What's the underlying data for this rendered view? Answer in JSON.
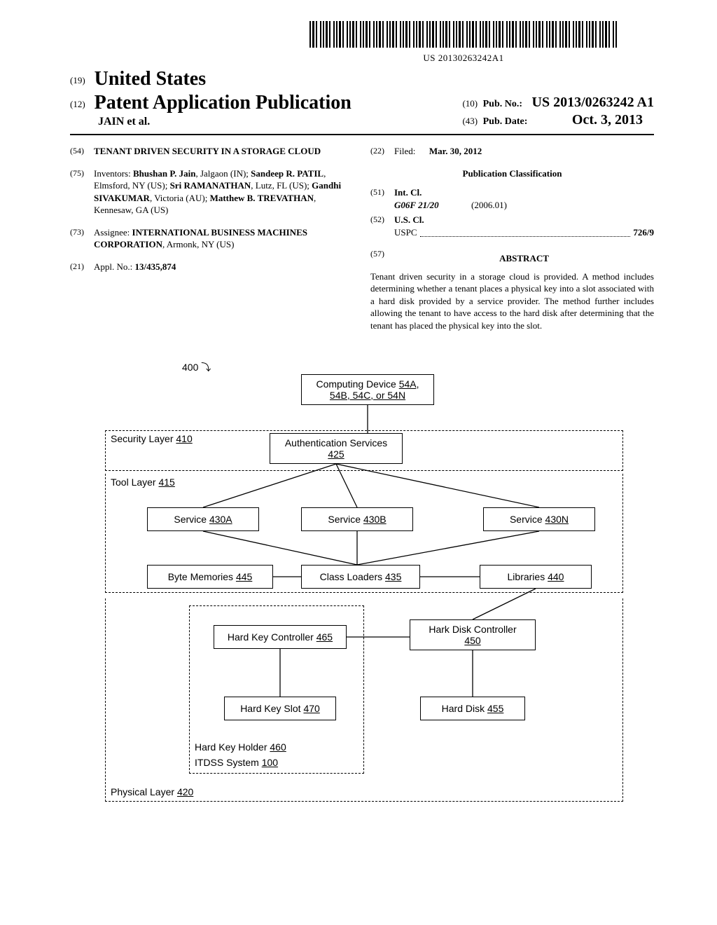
{
  "barcode_text": "US 20130263242A1",
  "header": {
    "country_num": "(19)",
    "country": "United States",
    "pub_num": "(12)",
    "pub_type": "Patent Application Publication",
    "authors": "JAIN et al.",
    "pubno_num": "(10)",
    "pubno_label": "Pub. No.:",
    "pubno_value": "US 2013/0263242 A1",
    "pubdate_num": "(43)",
    "pubdate_label": "Pub. Date:",
    "pubdate_value": "Oct. 3, 2013"
  },
  "left_col": {
    "title_num": "(54)",
    "title": "TENANT DRIVEN SECURITY IN A STORAGE CLOUD",
    "inventors_num": "(75)",
    "inventors_label": "Inventors:",
    "inventors_html": "Bhushan P. Jain, Jalgaon (IN); Sandeep R. PATIL, Elmsford, NY (US); Sri RAMANATHAN, Lutz, FL (US); Gandhi SIVAKUMAR, Victoria (AU); Matthew B. TREVATHAN, Kennesaw, GA (US)",
    "inventor_names": [
      "Bhushan P. Jain",
      "Sandeep R. PATIL",
      "Sri RAMANATHAN",
      "Gandhi SIVAKUMAR",
      "Matthew B. TREVATHAN"
    ],
    "assignee_num": "(73)",
    "assignee_label": "Assignee:",
    "assignee_value": "INTERNATIONAL BUSINESS MACHINES CORPORATION, Armonk, NY (US)",
    "applno_num": "(21)",
    "applno_label": "Appl. No.:",
    "applno_value": "13/435,874"
  },
  "right_col": {
    "filed_num": "(22)",
    "filed_label": "Filed:",
    "filed_value": "Mar. 30, 2012",
    "pubclass_heading": "Publication Classification",
    "intcl_num": "(51)",
    "intcl_label": "Int. Cl.",
    "intcl_code": "G06F 21/20",
    "intcl_date": "(2006.01)",
    "uscl_num": "(52)",
    "uscl_label": "U.S. Cl.",
    "uscl_sub": "USPC",
    "uscl_value": "726/9",
    "abstract_num": "(57)",
    "abstract_heading": "ABSTRACT",
    "abstract_text": "Tenant driven security in a storage cloud is provided. A method includes determining whether a tenant places a physical key into a slot associated with a hard disk provided by a service provider. The method further includes allowing the tenant to have access to the hard disk after determining that the tenant has placed the physical key into the slot."
  },
  "diagram": {
    "ref400": "400",
    "computing_device": "Computing Device 54A, 54B, 54C, or 54N",
    "security_layer": "Security Layer 410",
    "auth_services": "Authentication Services 425",
    "tool_layer": "Tool Layer 415",
    "service_a": "Service 430A",
    "service_b": "Service 430B",
    "service_n": "Service 430N",
    "byte_memories": "Byte Memories 445",
    "class_loaders": "Class Loaders 435",
    "libraries": "Libraries 440",
    "hard_key_controller": "Hard Key Controller 465",
    "hard_disk_controller": "Hark Disk Controller 450",
    "hard_key_slot": "Hard Key Slot 470",
    "hard_disk": "Hard Disk 455",
    "hard_key_holder": "Hard Key Holder 460",
    "itdss_system": "ITDSS System 100",
    "physical_layer": "Physical Layer 420"
  }
}
